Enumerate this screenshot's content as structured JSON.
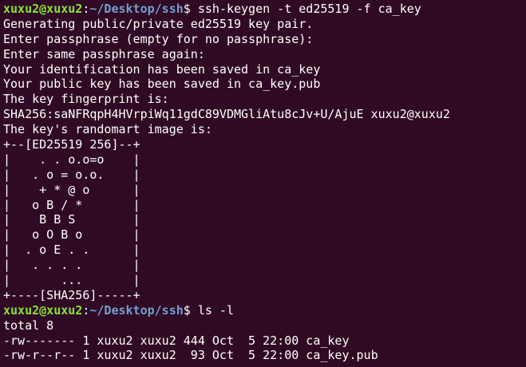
{
  "window": {
    "title": "",
    "background": "#300a24",
    "foreground": "#ffffff",
    "prompt_user_color": "#8ae234",
    "prompt_path_color": "#729fcf"
  },
  "session": [
    {
      "prompt": {
        "user": "xuxu2@xuxu2",
        "sep": ":",
        "path": "~/Desktop/ssh",
        "symbol": "$ "
      },
      "command": "ssh-keygen -t ed25519 -f ca_key",
      "output": [
        "Generating public/private ed25519 key pair.",
        "Enter passphrase (empty for no passphrase):",
        "Enter same passphrase again:",
        "Your identification has been saved in ca_key",
        "Your public key has been saved in ca_key.pub",
        "The key fingerprint is:",
        "SHA256:saNFRqpH4HVrpiWq11gdC89VDMGliAtu8cJv+U/AjuE xuxu2@xuxu2",
        "The key's randomart image is:",
        "+--[ED25519 256]--+",
        "|    . . o.o=o    |",
        "|   . o = o.o.    |",
        "|    + * @ o      |",
        "|   o B / *       |",
        "|    B B S        |",
        "|   o O B o       |",
        "|  . o E . .      |",
        "|   . . . .       |",
        "|       ...       |",
        "+----[SHA256]-----+"
      ]
    },
    {
      "prompt": {
        "user": "xuxu2@xuxu2",
        "sep": ":",
        "path": "~/Desktop/ssh",
        "symbol": "$ "
      },
      "command": "ls -l",
      "output": [
        "total 8",
        "-rw------- 1 xuxu2 xuxu2 444 Oct  5 22:00 ca_key",
        "-rw-r--r-- 1 xuxu2 xuxu2  93 Oct  5 22:00 ca_key.pub"
      ]
    }
  ]
}
